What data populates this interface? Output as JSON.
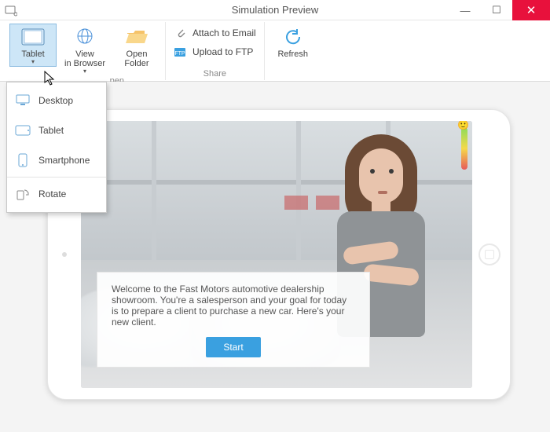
{
  "window": {
    "title": "Simulation Preview"
  },
  "ribbon": {
    "tablet_btn": "Tablet",
    "view_browser_btn": "View\nin Browser",
    "open_folder_btn": "Open\nFolder",
    "open_group_label": "pen",
    "attach_email": "Attach to Email",
    "upload_ftp": "Upload to FTP",
    "share_group_label": "Share",
    "refresh_btn": "Refresh"
  },
  "device_menu": {
    "desktop": "Desktop",
    "tablet": "Tablet",
    "smartphone": "Smartphone",
    "rotate": "Rotate"
  },
  "slide": {
    "dialog_text": "Welcome to the Fast Motors automotive dealership showroom. You're a salesperson and your goal for today is to prepare a client to purchase a new car. Here's your new client.",
    "start_btn": "Start"
  },
  "colors": {
    "accent": "#3aa0e0",
    "ribbon_highlight": "#cde6f7",
    "close_red": "#e8113c"
  }
}
